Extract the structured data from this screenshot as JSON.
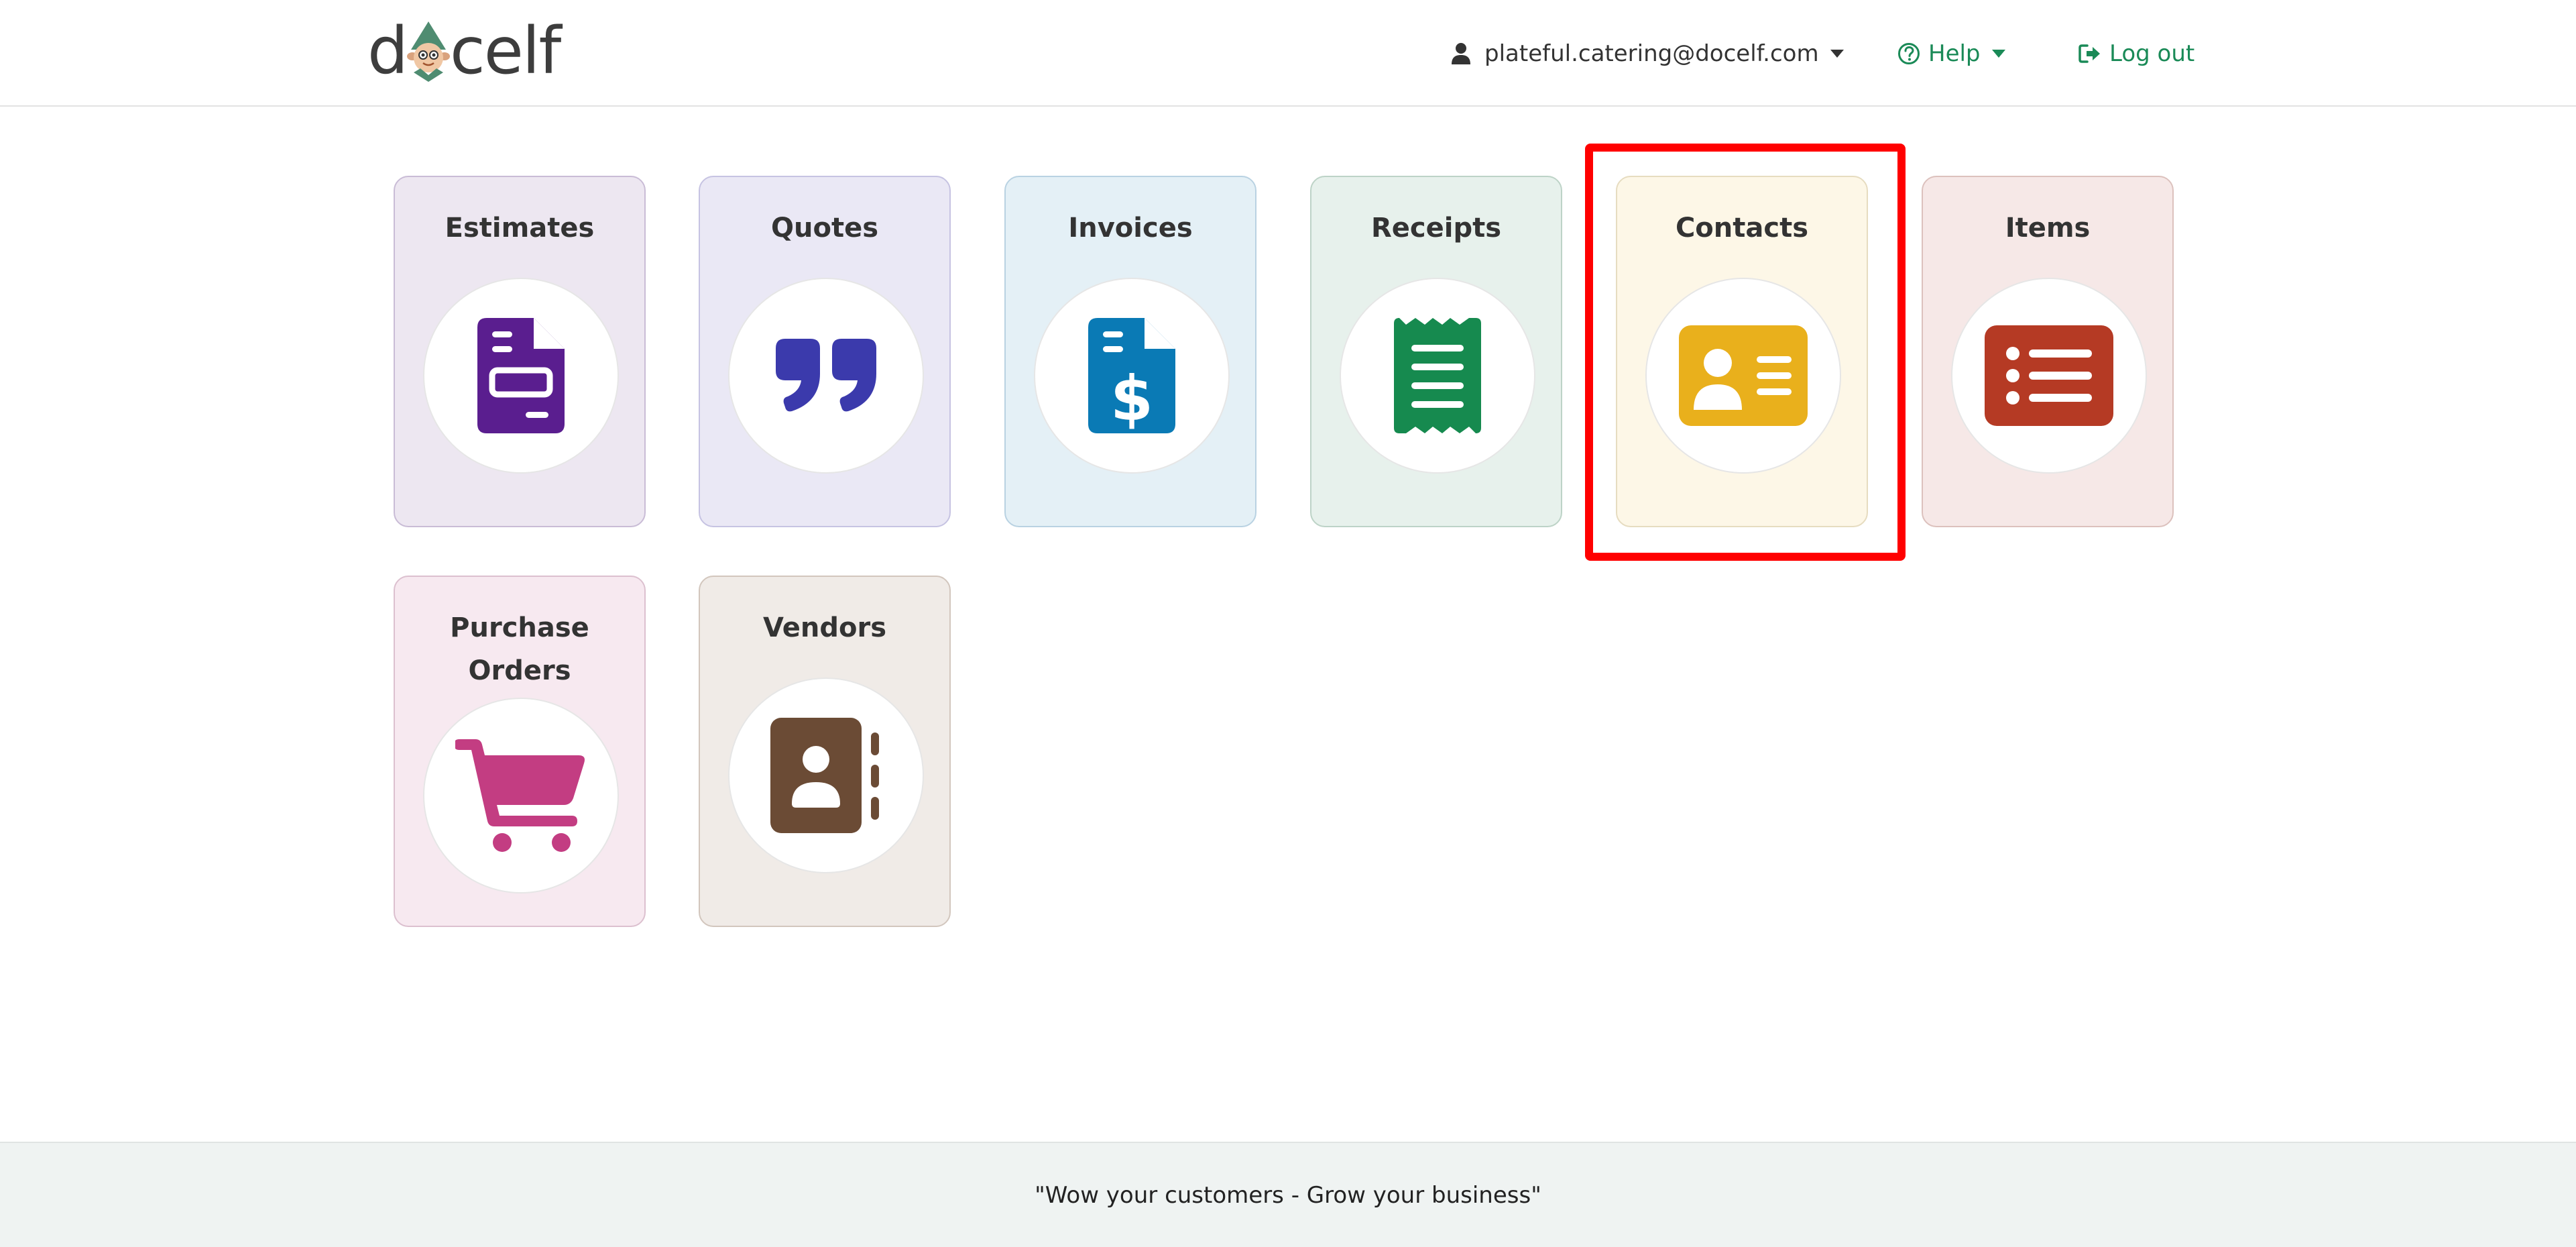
{
  "header": {
    "logo_text_left": "d",
    "logo_text_right": "celf",
    "user_email": "plateful.catering@docelf.com",
    "help_label": "Help",
    "logout_label": "Log out"
  },
  "tiles": [
    {
      "label": "Estimates",
      "icon": "estimate-document-icon",
      "bg": "#ede7f1",
      "color": "#5a1e8f"
    },
    {
      "label": "Quotes",
      "icon": "quote-marks-icon",
      "bg": "#eae8f5",
      "color": "#3b3aac"
    },
    {
      "label": "Invoices",
      "icon": "invoice-dollar-icon",
      "bg": "#e4f0f6",
      "color": "#0a7ab5"
    },
    {
      "label": "Receipts",
      "icon": "receipt-icon",
      "bg": "#e7f1ec",
      "color": "#168a4f"
    },
    {
      "label": "Contacts",
      "icon": "contact-card-icon",
      "bg": "#fdf7e7",
      "color": "#e9b01c"
    },
    {
      "label": "Items",
      "icon": "list-icon",
      "bg": "#f6e8e7",
      "color": "#b53a24"
    },
    {
      "label": "Purchase Orders",
      "label_line1": "Purchase",
      "label_line2": "Orders",
      "icon": "shopping-cart-icon",
      "bg": "#f7e9f0",
      "color": "#c33d82"
    },
    {
      "label": "Vendors",
      "icon": "address-book-icon",
      "bg": "#f0ebe7",
      "color": "#6b4b35"
    }
  ],
  "footer": {
    "tagline": "\"Wow your customers - Grow your business\""
  }
}
